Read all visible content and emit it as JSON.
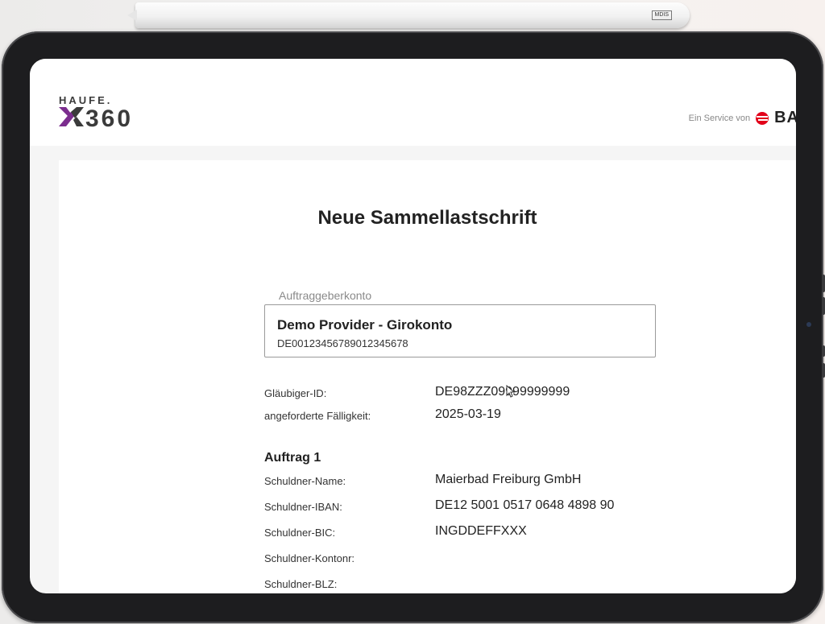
{
  "pencil": {
    "brand": "MDIS"
  },
  "header": {
    "logo_top": "HAUFE.",
    "logo_bottom": "X360",
    "service_text": "Ein Service von",
    "service_brand": "BA"
  },
  "form": {
    "title": "Neue Sammellastschrift",
    "account_label": "Auftraggeberkonto",
    "account_name": "Demo Provider - Girokonto",
    "account_iban": "DE00123456789012345678",
    "fields": [
      {
        "label": "Gläubiger-ID:",
        "value": "DE98ZZZ09999999999"
      },
      {
        "label": "angeforderte Fälligkeit:",
        "value": "2025-03-19"
      }
    ],
    "order": {
      "title": "Auftrag 1",
      "fields": [
        {
          "label": "Schuldner-Name:",
          "value": "Maierbad Freiburg GmbH"
        },
        {
          "label": "Schuldner-IBAN:",
          "value": "DE12 5001 0517 0648 4898 90"
        },
        {
          "label": "Schuldner-BIC:",
          "value": "INGDDEFFXXX"
        },
        {
          "label": "Schuldner-Kontonr:",
          "value": ""
        },
        {
          "label": "Schuldner-BLZ:",
          "value": ""
        }
      ]
    }
  },
  "colors": {
    "logo_accent": "#7b2d8e",
    "logo_dark": "#3b3b3b",
    "service_red": "#e2001a"
  }
}
